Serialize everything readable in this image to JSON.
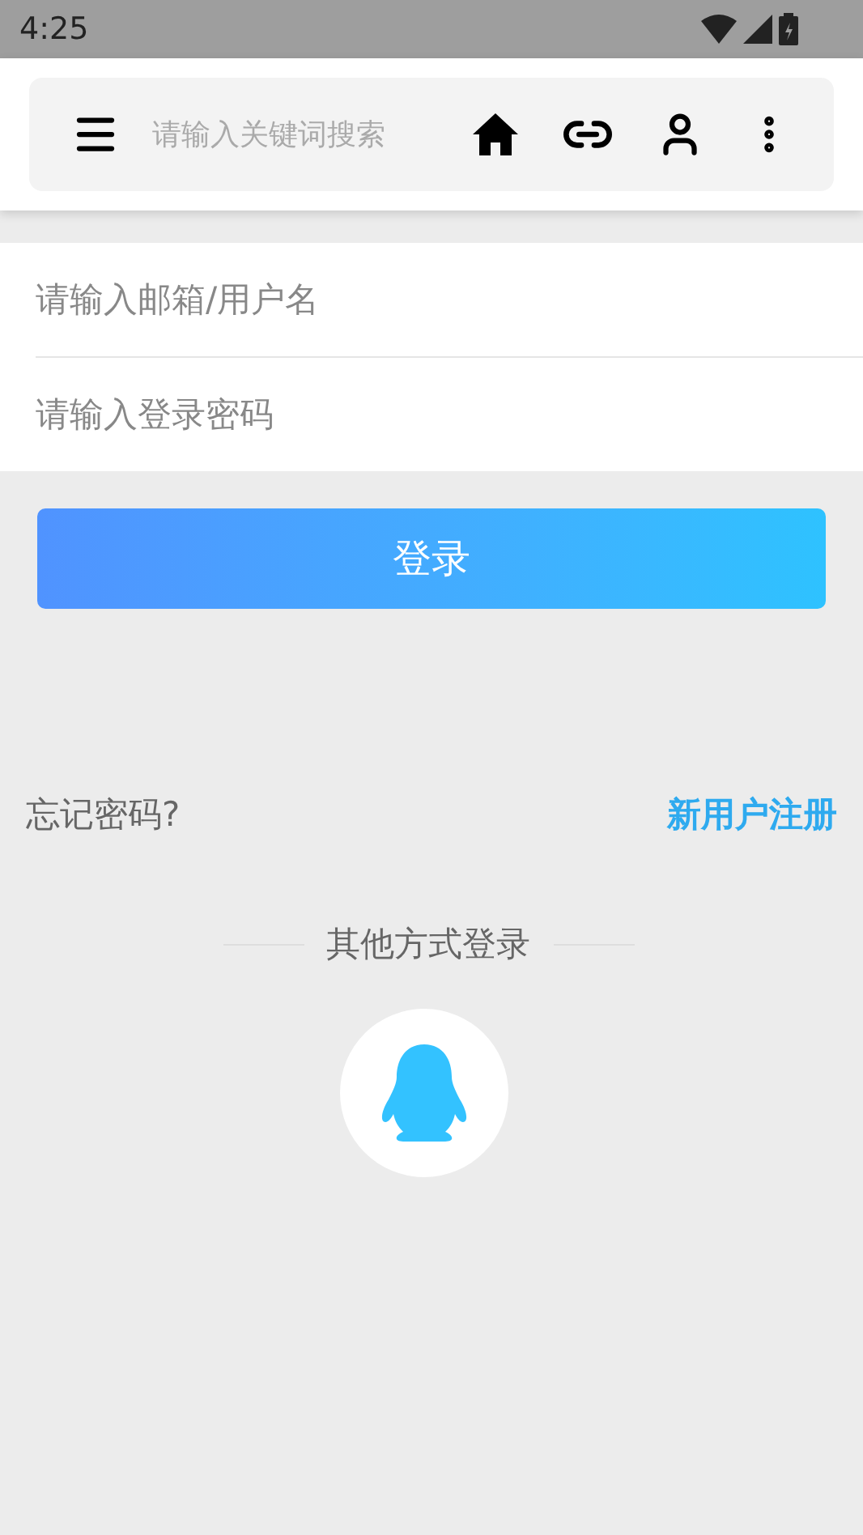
{
  "status_bar": {
    "time": "4:25"
  },
  "header": {
    "search": {
      "placeholder": "请输入关键词搜索"
    }
  },
  "form": {
    "fields": [
      {
        "placeholder": "请输入邮箱/用户名"
      },
      {
        "placeholder": "请输入登录密码"
      }
    ],
    "submit": "登录"
  },
  "links": {
    "forgot": "忘记密码?",
    "register": "新用户注册"
  },
  "other_login": {
    "title": "其他方式登录"
  }
}
